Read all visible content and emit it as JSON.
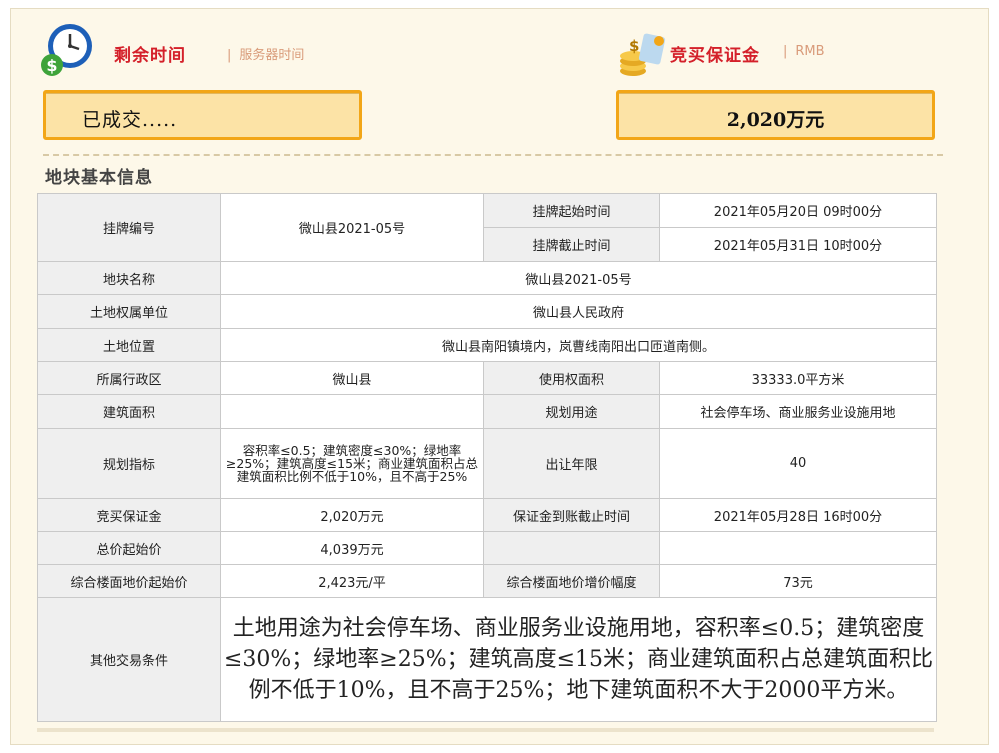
{
  "header": {
    "remaining_label": "剩余时间",
    "server_time_label": "服务器时间",
    "deposit_label": "竞买保证金",
    "currency_label": "RMB"
  },
  "status": {
    "left_text": "已成交.....",
    "right_text": "2,020万元"
  },
  "section_title": "地块基本信息",
  "table": {
    "listing_no_key": "挂牌编号",
    "listing_no_val": "微山县2021-05号",
    "start_key": "挂牌起始时间",
    "start_val": "2021年05月20日 09时00分",
    "end_key": "挂牌截止时间",
    "end_val": "2021年05月31日 10时00分",
    "name_key": "地块名称",
    "name_val": "微山县2021-05号",
    "owner_key": "土地权属单位",
    "owner_val": "微山县人民政府",
    "location_key": "土地位置",
    "location_val": "微山县南阳镇境内，岚曹线南阳出口匝道南侧。",
    "district_key": "所属行政区",
    "district_val": "微山县",
    "use_area_key": "使用权面积",
    "use_area_val": "33333.0平方米",
    "build_area_key": "建筑面积",
    "build_area_val": "",
    "purpose_key": "规划用途",
    "purpose_val": "社会停车场、商业服务业设施用地",
    "plan_key": "规划指标",
    "plan_val": "容积率≤0.5；建筑密度≤30%；绿地率≥25%；建筑高度≤15米；商业建筑面积占总建筑面积比例不低于10%，且不高于25%",
    "term_key": "出让年限",
    "term_val": "40",
    "deposit_key": "竞买保证金",
    "deposit_val": "2,020万元",
    "deposit_deadline_key": "保证金到账截止时间",
    "deposit_deadline_val": "2021年05月28日 16时00分",
    "start_price_key": "总价起始价",
    "start_price_val": "4,039万元",
    "floor_price_key": "综合楼面地价起始价",
    "floor_price_val": "2,423元/平",
    "increment_key": "综合楼面地价增价幅度",
    "increment_val": "73元",
    "other_key": "其他交易条件",
    "other_val": "土地用途为社会停车场、商业服务业设施用地，容积率≤0.5；建筑密度≤30%；绿地率≥25%；建筑高度≤15米；商业建筑面积占总建筑面积比例不低于10%，且不高于25%；地下建筑面积不大于2000平方米。"
  },
  "colors": {
    "accent_red": "#d4202a",
    "box_fill": "#fce3a6",
    "box_border": "#f2a617",
    "panel_bg": "#fdf8e9"
  },
  "icons": [
    "clock-icon",
    "coins-icon"
  ]
}
